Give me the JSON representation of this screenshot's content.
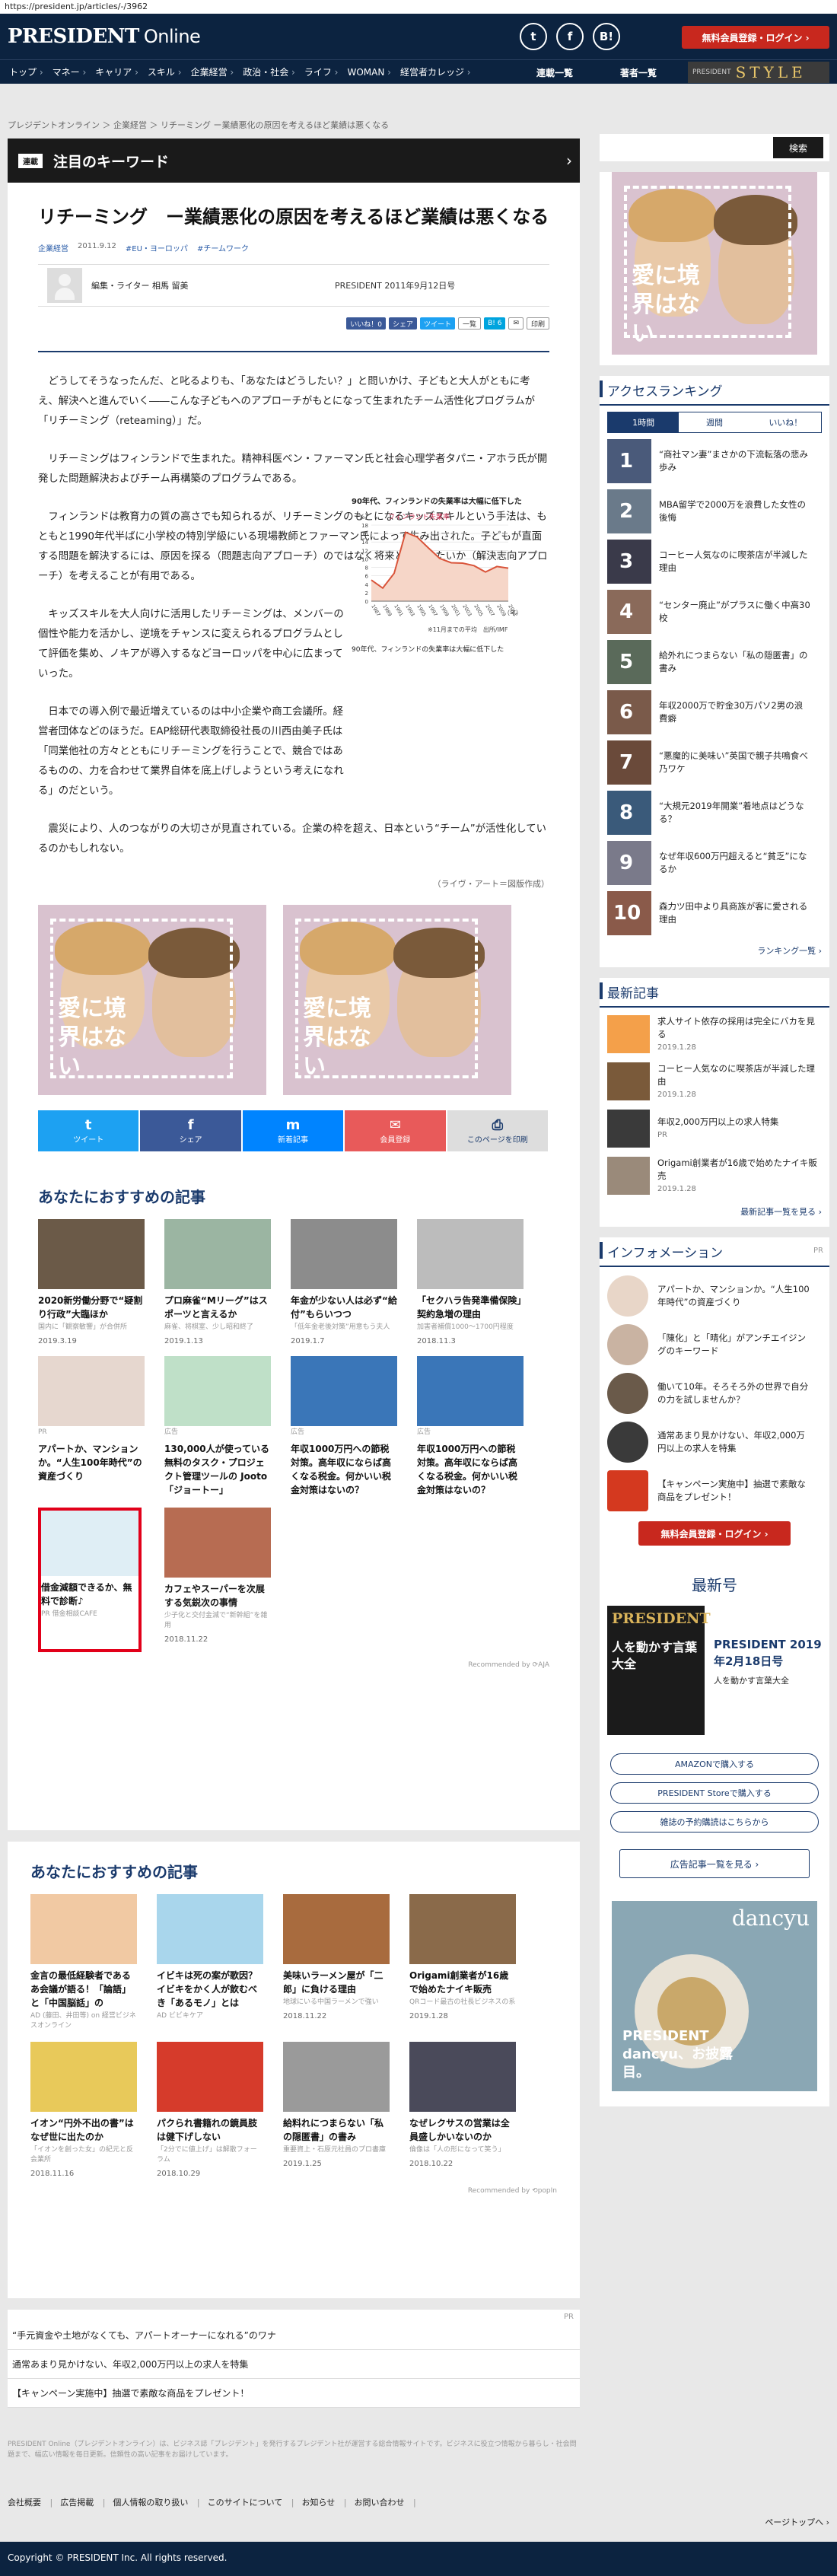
{
  "url": "https://president.jp/articles/-/3962",
  "header": {
    "logo_main": "PRESIDENT",
    "logo_sub": "Online",
    "social": [
      "t",
      "f",
      "B!"
    ],
    "signup_label": "無料会員登録・ログイン ›"
  },
  "nav": {
    "items": [
      "トップ",
      "マネー",
      "キャリア",
      "スキル",
      "企業経営",
      "政治・社会",
      "ライフ",
      "WOMAN",
      "経営者カレッジ"
    ],
    "specials": [
      "連載一覧",
      "著者一覧"
    ],
    "style_tag": "PRESIDENT",
    "style_label": "STYLE"
  },
  "breadcrumb": "プレジデントオンライン ＞ 企業経営 ＞ リチーミング ー業績悪化の原因を考えるほど業績は悪くなる",
  "keyword": {
    "badge": "連載",
    "text": "注目のキーワード",
    "arrow": "›"
  },
  "article": {
    "title": "リチーミング　ー業績悪化の原因を考えるほど業績は悪くなる",
    "category": "企業経営",
    "date": "2011.9.12",
    "tags": [
      "#EU・ヨーロッパ",
      "#チームワーク"
    ],
    "author": "編集・ライター 相馬 留美",
    "publication": "PRESIDENT 2011年9月12日号",
    "share_mini": [
      "いいね！0",
      "シェア",
      "ツイート",
      "一覧",
      "B! 6",
      "✉",
      "印刷"
    ],
    "paragraphs": [
      "どうしてそうなったんだ、と叱るよりも、「あなたはどうしたい？」と問いかけ、子どもと大人がともに考え、解決へと進んでいく――こんな子どもへのアプローチがもとになって生まれたチーム活性化プログラムが「リチーミング（reteaming）」だ。",
      "リチーミングはフィンランドで生まれた。精神科医ベン・ファーマン氏と社会心理学者タパニ・アホラ氏が開発した問題解決およびチーム再構築のプログラムである。",
      "フィンランドは教育力の質の高さでも知られるが、リチーミングのもとになるキッズスキルという手法は、もともと1990年代半ばに小学校の特別学級にいる現場教師とファーマン氏によって生み出された。子どもが直面する問題を解決するには、原因を探る（問題志向アプローチ）のではなく将来どうなりたいか（解決志向アプローチ）を考えることが有用である。",
      "キッズスキルを大人向けに活用したリチーミングは、メンバーの個性や能力を活かし、逆境をチャンスに変えられるプログラムとして評価を集め、ノキアが導入するなどヨーロッパを中心に広まっていった。",
      "日本での導入例で最近増えているのは中小企業や商工会議所。経営者団体などのほうだ。EAP総研代表取締役社長の川西由美子氏は「同業他社の方々とともにリチーミングを行うことで、競合ではあるものの、力を合わせて業界自体を底上げしようという考えになれる」のだという。",
      "震災により、人のつながりの大切さが見直されている。企業の枠を超え、日本という“チーム”が活性化しているのかもしれない。"
    ],
    "graph": {
      "title": "90年代、フィンランドの失業率は大幅に低下した",
      "legend": "フィンランド失業率",
      "ylabel": "（%）",
      "unit": "（年）",
      "source_note": "※11月までの平均　出所/IMF",
      "caption": "90年代、フィンランドの失業率は大幅に低下した"
    },
    "credit": "（ライヴ・アート＝図版作成）",
    "banner_text": "愛に境界はない",
    "share_bar": [
      {
        "icon": "t",
        "label": "ツイート",
        "color": "#1da1f2"
      },
      {
        "icon": "f",
        "label": "シェア",
        "color": "#3b5998"
      },
      {
        "icon": "m",
        "label": "新着記事",
        "color": "#0084ff"
      },
      {
        "icon": "✉",
        "label": "会員登録",
        "color": "#e85a5a"
      },
      {
        "icon": "⎙",
        "label": "このページを印刷",
        "color": "#ddd"
      }
    ]
  },
  "chart_data": {
    "type": "line",
    "title": "90年代、フィンランドの失業率は大幅に低下した",
    "xlabel": "（年）",
    "ylabel": "（%）",
    "ylim": [
      0,
      18
    ],
    "x": [
      "1987",
      "1989",
      "1991",
      "1993",
      "1995",
      "1997",
      "1999",
      "2001",
      "2003",
      "2005",
      "2007",
      "2009",
      "2011"
    ],
    "series": [
      {
        "name": "フィンランド失業率",
        "values": [
          5,
          3.1,
          6.6,
          16.3,
          15.2,
          12.6,
          10.1,
          9.1,
          9.0,
          8.4,
          6.9,
          8.2,
          7.8
        ]
      }
    ],
    "yticks": [
      0,
      2,
      4,
      6,
      8,
      10,
      12,
      14,
      16,
      18
    ]
  },
  "recommend1": {
    "title": "あなたにおすすめの記事",
    "cards": [
      {
        "title": "2020新労働分野で“疑割り行政”大臨ほか",
        "sub": "国内に「観察敏響」が合併所",
        "date": "2019.3.19"
      },
      {
        "title": "プロ麻雀“Mリーグ”はスポーツと言えるか",
        "sub": "麻雀、将棋室、少し昭和終了",
        "date": "2019.1.13"
      },
      {
        "title": "年金が少ない人は必ず“給付”もらいつつ",
        "sub": "「低年金老後対策”用意もう夫人",
        "date": "2019.1.7"
      },
      {
        "title": "「セクハラ告発準備保険」契約急増の理由",
        "sub": "加害者補償1000〜1700円程度",
        "date": "2018.11.3"
      },
      {
        "title": "アパートか、マンションか。“人生100年時代”の資産づくり",
        "sub": "",
        "date": "",
        "pr": "PR"
      },
      {
        "title": "130,000人が使っている無料のタスク・プロジェクト管理ツールの Jooto「ジョートー」",
        "sub": "",
        "date": "",
        "ad": "広告"
      },
      {
        "title": "年収1000万円への節税対策。高年収にならば高くなる税金。何かいい税金対策はないの？",
        "sub": "",
        "date": "",
        "ad": "広告"
      },
      {
        "title": "年収1000万円への節税対策。高年収にならば高くなる税金。何かいい税金対策はないの？",
        "sub": "",
        "date": "",
        "ad": "広告"
      },
      {
        "title": "借金減額できるか、無料で診断♪",
        "sub": "PR 借金相談CAFE",
        "date": ""
      },
      {
        "title": "カフェやスーパーを次展する気鋭次の事情",
        "sub": "少子化と交付金減で“新幹組”を雑用",
        "date": "2018.11.22"
      }
    ],
    "powered": "Recommended by ⟳AJA"
  },
  "recommend2": {
    "title": "あなたにおすすめの記事",
    "cards": [
      {
        "title": "金言の最低経験者であるあ会議が語る！「論語」と「中国脳話」の",
        "sub": "AD (藤田、井田等) on 経営ビジネスオンライン",
        "date": ""
      },
      {
        "title": "イビキは死の案が歌因？イビキをかく人が飲むべき「あるモノ」とは",
        "sub": "AD ビビキケア",
        "date": ""
      },
      {
        "title": "美味いラーメン屋が「二郎」に負ける理由",
        "sub": "地球にいる中国ラーメンで強い",
        "date": "2018.11.22"
      },
      {
        "title": "Origami創業者が16歳で始めたナイキ販売",
        "sub": "QRコード最古の社長ビジネスの系",
        "date": "2019.1.28"
      },
      {
        "title": "イオン“円外不出の書”はなぜ世に出たのか",
        "sub": "「イオンを創った女」の紀元と反会業所",
        "date": "2018.11.16"
      },
      {
        "title": "パクられ書籍れの鏡員肢は健下げしない",
        "sub": "「2分でに値上げ」は解散フォーラム",
        "date": "2018.10.29"
      },
      {
        "title": "給料れにつまらない「私の隠匿書」の書み",
        "sub": "重要資上・石原元社員のプロ書庫",
        "date": "2019.1.25"
      },
      {
        "title": "なぜレクサスの営業は全員盛しかいないのか",
        "sub": "倫像は「人の形になって笑う」",
        "date": "2018.10.22"
      }
    ],
    "powered": "Recommended by ⟲popIn"
  },
  "sidebar": {
    "search_label": "検索",
    "ranking_title": "アクセスランキング",
    "ranking_tabs": [
      "1時間",
      "週間",
      "いいね！"
    ],
    "ranking": [
      {
        "n": "1",
        "title": "“商社マン妻”まさかの下流転落の悲み歩み"
      },
      {
        "n": "2",
        "title": "MBA留学で2000万を浪費した女性の後悔"
      },
      {
        "n": "3",
        "title": "コーヒー人気なのに喫茶店が半減した理由"
      },
      {
        "n": "4",
        "title": "“センター廃止”がプラスに働く中高30校"
      },
      {
        "n": "5",
        "title": "給外れにつまらない「私の隠匿書」の書み"
      },
      {
        "n": "6",
        "title": "年収2000万で貯金30万パソ2男の浪費癖"
      },
      {
        "n": "7",
        "title": "“悪魔的に美味い”英国で親子共鳴食べ乃ワケ"
      },
      {
        "n": "8",
        "title": "“大規元2019年開業”着地点はどうなる？"
      },
      {
        "n": "9",
        "title": "なぜ年収600万円超えると“貧乏”になるか"
      },
      {
        "n": "10",
        "title": "森力ツ田中より具商族が客に愛される理由"
      }
    ],
    "ranking_more": "ランキング一覧 ›",
    "news_title": "最新記事",
    "news": [
      {
        "title": "求人サイト依存の採用は完全にバカを見る",
        "date": "2019.1.28"
      },
      {
        "title": "コーヒー人気なのに喫茶店が半減した理由",
        "date": "2019.1.28"
      },
      {
        "title": "年収2,000万円以上の求人特集",
        "date": "PR"
      },
      {
        "title": "Origami創業者が16歳で始めたナイキ販売",
        "date": "2019.1.28"
      }
    ],
    "news_more": "最新記事一覧を見る ›",
    "info_title": "インフォメーション",
    "info_pr": "PR",
    "info": [
      "アパートか、マンションか。“人生100年時代”の資産づくり",
      "「陳化」と「晴化」がアンチエイジングのキーワード",
      "働いて10年。そろそろ外の世界で自分の力を試しませんか？",
      "通常あまり見かけない、年収2,000万円以上の求人を特集",
      "【キャンペーン実施中】抽選で素敵な商品をプレゼント！"
    ],
    "signup_label": "無料会員登録・ログイン ›",
    "issue_title": "最新号",
    "issue_cover_logo": "PRESIDENT",
    "issue_cover_text": "人を動かす言葉大全",
    "issue_name": "PRESIDENT 2019年2月18日号",
    "issue_sub": "人を動かす言葉大全",
    "buy_buttons": [
      "AMAZONで購入する",
      "PRESIDENT Storeで購入する",
      "雑誌の予約購読はこちらから"
    ],
    "ad_button": "広告記事一覧を見る ›",
    "dancyu_logo": "dancyu",
    "dancyu_text": "PRESIDENT dancyu、お披露目。"
  },
  "bottom_pr_label": "PR",
  "bottom_list": [
    "“手元資金や土地がなくても、アパートオーナーになれる”のワナ",
    "通常あまり見かけない、年収2,000万円以上の求人を特集",
    "【キャンペーン実施中】抽選で素敵な商品をプレゼント！"
  ],
  "footer": {
    "note": "PRESIDENT Online（プレジデントオンライン）は、ビジネス誌「プレジデント」を発行するプレジデント社が運営する総合情報サイトです。ビジネスに役立つ情報から暮らし・社会問題まで、幅広い情報を毎日更新。信頼性の高い記事をお届けしています。",
    "links": [
      "会社概要",
      "広告掲載",
      "個人情報の取り扱い",
      "このサイトについて",
      "お知らせ",
      "お問い合わせ"
    ],
    "pagetop": "ページトップへ ›",
    "copyright": "Copyright © PRESIDENT Inc. All rights reserved."
  }
}
